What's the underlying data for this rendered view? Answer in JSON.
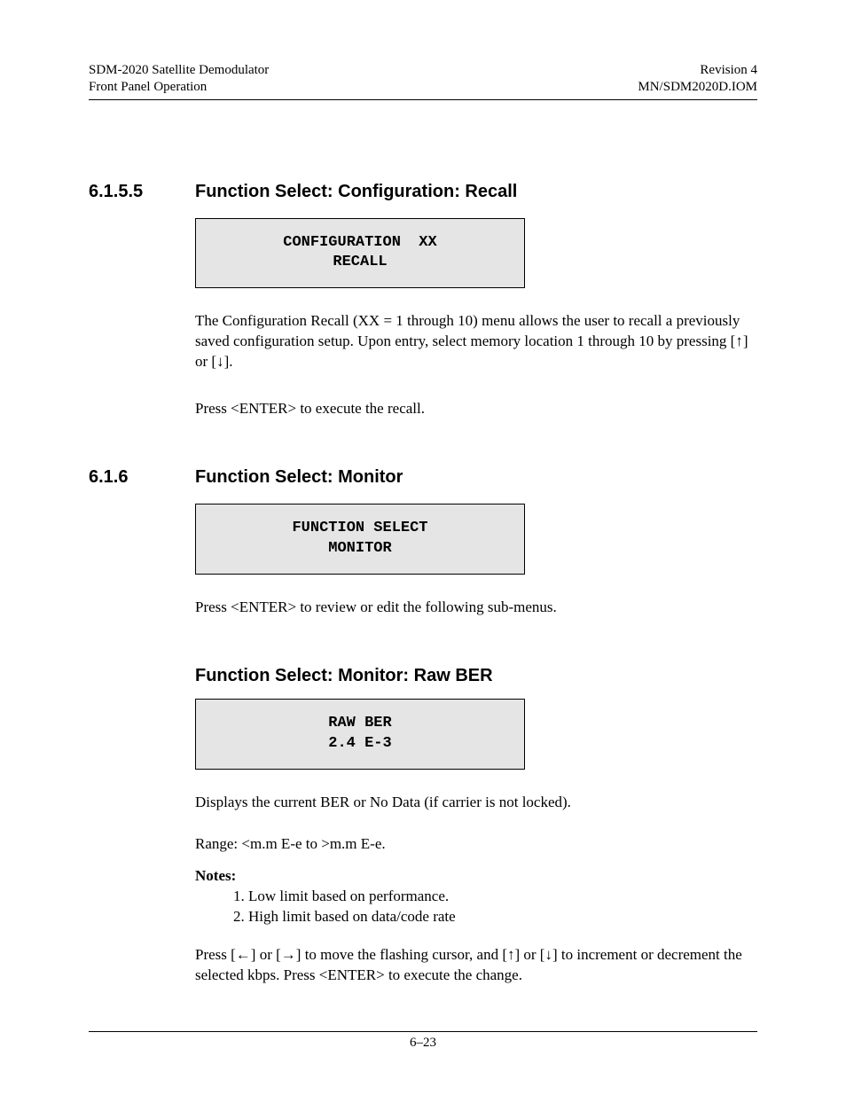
{
  "header": {
    "left_line1": "SDM-2020 Satellite Demodulator",
    "left_line2": "Front Panel Operation",
    "right_line1": "Revision 4",
    "right_line2": "MN/SDM2020D.IOM"
  },
  "sections": {
    "recall": {
      "number": "6.1.5.5",
      "title": "Function Select: Configuration: Recall",
      "display": "CONFIGURATION  XX\nRECALL",
      "para1": "The Configuration Recall (XX = 1 through 10) menu allows the user to recall a previously saved configuration setup. Upon entry, select memory location 1 through 10 by pressing [↑] or [↓].",
      "para2": "Press <ENTER> to execute the recall."
    },
    "monitor": {
      "number": "6.1.6",
      "title": "Function Select: Monitor",
      "display": "FUNCTION SELECT\nMONITOR",
      "para1": "Press <ENTER> to review or edit the following sub-menus."
    },
    "rawber": {
      "title": "Function Select: Monitor: Raw BER",
      "display": "RAW BER\n2.4 E-3",
      "para1": "Displays the current BER or No Data (if carrier is not locked).",
      "para2": "Range: <m.m E-e to >m.m E-e.",
      "notes_label": "Notes:",
      "notes": [
        "Low limit based on performance.",
        "High limit based on data/code rate"
      ],
      "para3": "Press [←] or [→] to move the flashing cursor, and [↑] or [↓] to increment or decrement the selected kbps. Press <ENTER> to execute the change."
    }
  },
  "footer": {
    "page": "6–23"
  }
}
